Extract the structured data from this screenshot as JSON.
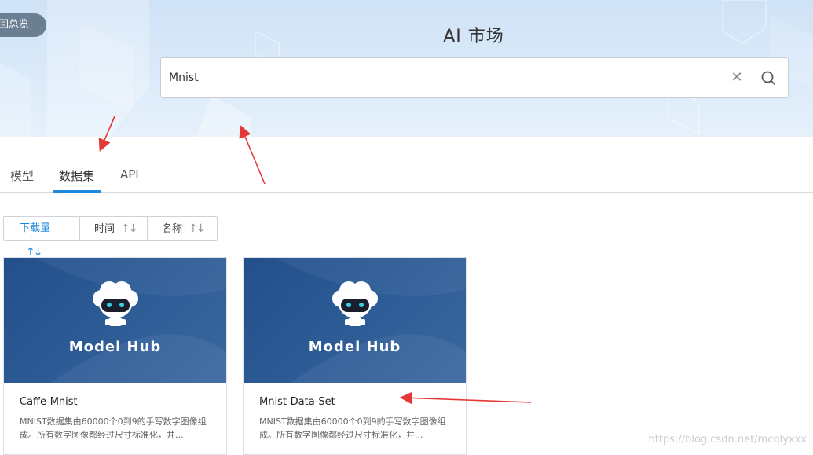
{
  "header": {
    "back_label": "回总览",
    "title": "AI 市场"
  },
  "search": {
    "value": "Mnist",
    "clear_icon": "close-icon",
    "search_icon": "search-icon"
  },
  "tabs": [
    {
      "label": "模型",
      "active": false
    },
    {
      "label": "数据集",
      "active": true
    },
    {
      "label": "API",
      "active": false
    }
  ],
  "sort": [
    {
      "label": "下载量",
      "active": true
    },
    {
      "label": "时间",
      "active": false
    },
    {
      "label": "名称",
      "active": false
    }
  ],
  "cards": [
    {
      "logo": "Model Hub",
      "name": "Caffe-Mnist",
      "description": "MNIST数据集由60000个0到9的手写数字图像组成。所有数字图像都经过尺寸标准化，并..."
    },
    {
      "logo": "Model Hub",
      "name": "Mnist-Data-Set",
      "description": "MNIST数据集由60000个0到9的手写数字图像组成。所有数字图像都经过尺寸标准化，并..."
    }
  ],
  "watermark": "https://blog.csdn.net/mcqlyxxx",
  "colors": {
    "accent": "#1d8ae0",
    "banner": "#2d5b96",
    "annotation_arrow": "#e53935"
  }
}
